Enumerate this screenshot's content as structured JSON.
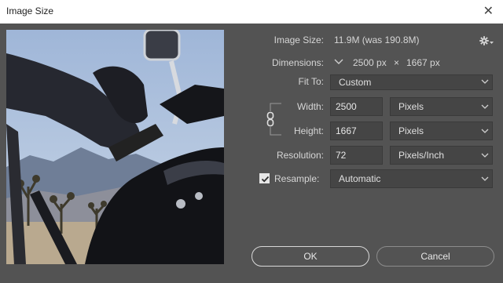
{
  "window": {
    "title": "Image Size"
  },
  "image_size": {
    "label": "Image Size:",
    "value": "11.9M (was 190.8M)"
  },
  "dimensions": {
    "label": "Dimensions:",
    "width": "2500 px",
    "sep": "×",
    "height": "1667 px"
  },
  "fit_to": {
    "label": "Fit To:",
    "value": "Custom"
  },
  "width": {
    "label": "Width:",
    "value": "2500",
    "unit": "Pixels"
  },
  "height": {
    "label": "Height:",
    "value": "1667",
    "unit": "Pixels"
  },
  "resolution": {
    "label": "Resolution:",
    "value": "72",
    "unit": "Pixels/Inch"
  },
  "resample": {
    "label": "Resample:",
    "checked": true,
    "value": "Automatic"
  },
  "buttons": {
    "ok": "OK",
    "cancel": "Cancel"
  },
  "icons": [
    "close-icon",
    "gear-icon",
    "chevron-down-icon",
    "link-icon",
    "checkmark-icon"
  ]
}
